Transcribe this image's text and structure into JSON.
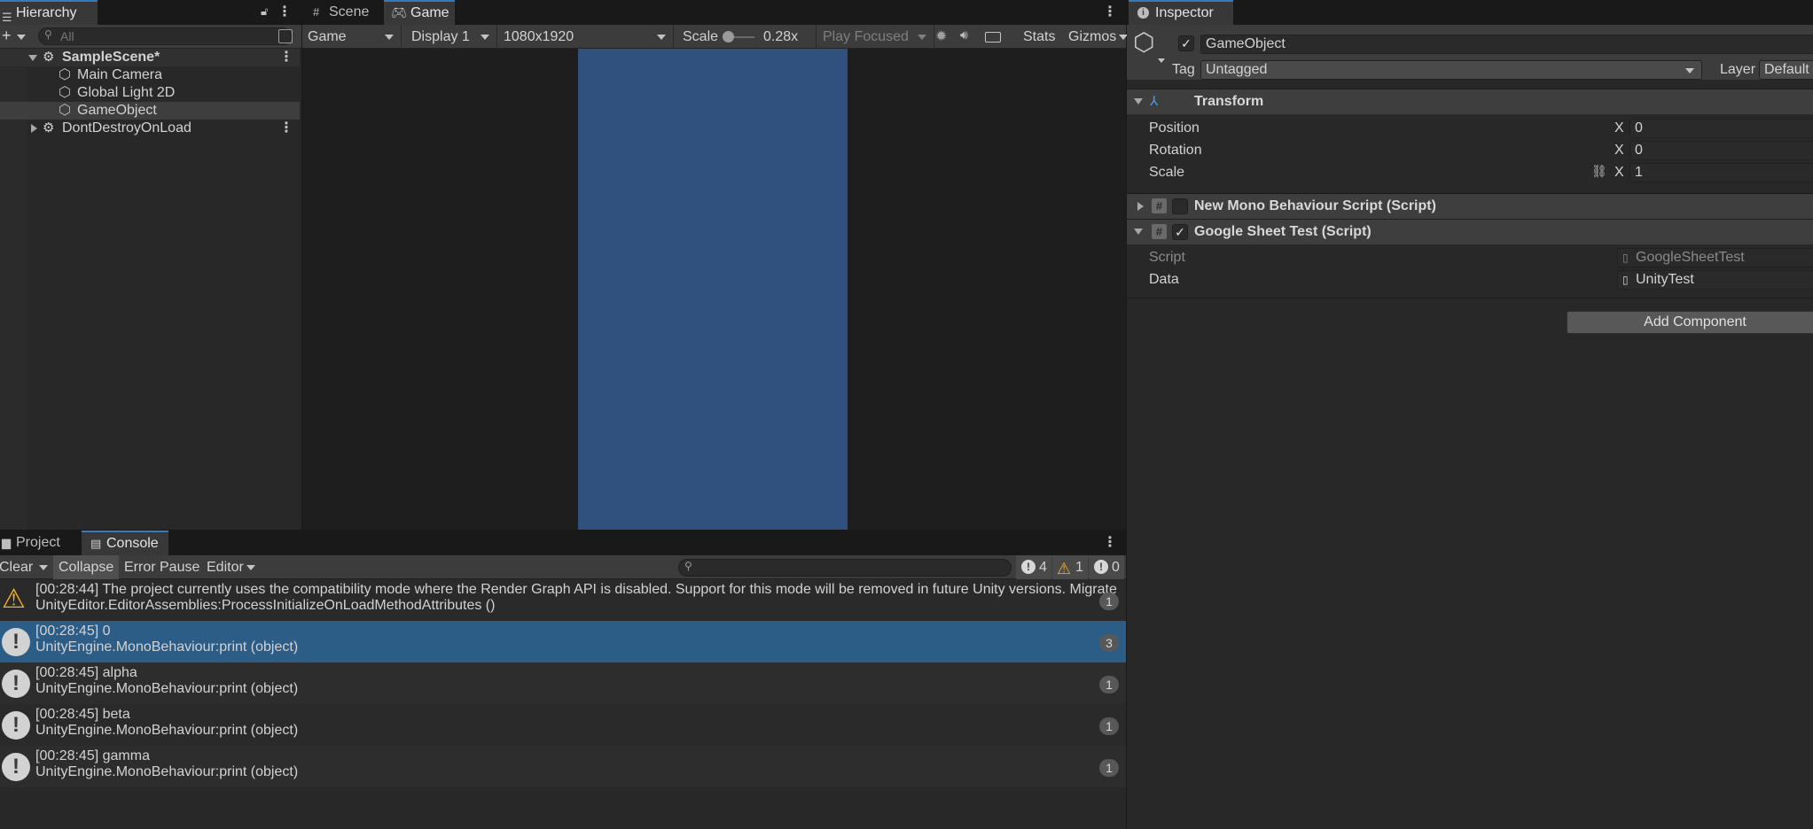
{
  "hierarchy": {
    "tab_label": "Hierarchy",
    "search_placeholder": "All",
    "items": [
      {
        "label": "SampleScene*"
      },
      {
        "label": "Main Camera"
      },
      {
        "label": "Global Light 2D"
      },
      {
        "label": "GameObject"
      },
      {
        "label": "DontDestroyOnLoad"
      }
    ]
  },
  "game_view": {
    "tabs": [
      {
        "label": "Scene"
      },
      {
        "label": "Game"
      }
    ],
    "toolbar": {
      "mode": "Game",
      "display": "Display 1",
      "resolution": "1080x1920",
      "scale_label": "Scale",
      "scale_value": "0.28x",
      "play_mode": "Play Focused",
      "stats": "Stats",
      "gizmos": "Gizmos"
    },
    "viewport_color": "#30507d"
  },
  "console": {
    "tabs": [
      {
        "label": "Project"
      },
      {
        "label": "Console"
      }
    ],
    "toolbar": {
      "clear": "Clear",
      "collapse": "Collapse",
      "error_pause": "Error Pause",
      "editor": "Editor",
      "log_count": "4",
      "warning_count": "1",
      "error_count": "0"
    },
    "entries": [
      {
        "type": "warning",
        "line1": "[00:28:44] The project currently uses the compatibility mode where the Render Graph API is disabled. Support for this mode will be removed in future Unity versions. Migrate",
        "line2": "UnityEditor.EditorAssemblies:ProcessInitializeOnLoadMethodAttributes ()",
        "count": "1"
      },
      {
        "type": "log",
        "line1": "[00:28:45] 0",
        "line2": "UnityEngine.MonoBehaviour:print (object)",
        "count": "3",
        "selected": true
      },
      {
        "type": "log",
        "line1": "[00:28:45] alpha",
        "line2": "UnityEngine.MonoBehaviour:print (object)",
        "count": "1"
      },
      {
        "type": "log",
        "line1": "[00:28:45] beta",
        "line2": "UnityEngine.MonoBehaviour:print (object)",
        "count": "1"
      },
      {
        "type": "log",
        "line1": "[00:28:45] gamma",
        "line2": "UnityEngine.MonoBehaviour:print (object)",
        "count": "1"
      }
    ],
    "selected_color": "#2c5d87"
  },
  "inspector": {
    "tab_label": "Inspector",
    "object_name": "GameObject",
    "tag_label": "Tag",
    "tag_value": "Untagged",
    "layer_label": "Layer",
    "layer_value": "Default",
    "transform": {
      "title": "Transform",
      "rows": [
        {
          "label": "Position",
          "axis": "X",
          "value": "0"
        },
        {
          "label": "Rotation",
          "axis": "X",
          "value": "0"
        },
        {
          "label": "Scale",
          "axis": "X",
          "value": "1"
        }
      ]
    },
    "components": [
      {
        "title": "New Mono Behaviour Script (Script)",
        "enabled": false
      },
      {
        "title": "Google Sheet Test (Script)",
        "enabled": true
      }
    ],
    "script_fields": [
      {
        "label": "Script",
        "value": "GoogleSheetTest"
      },
      {
        "label": "Data",
        "value": "UnityTest"
      }
    ],
    "add_component": "Add Component"
  }
}
